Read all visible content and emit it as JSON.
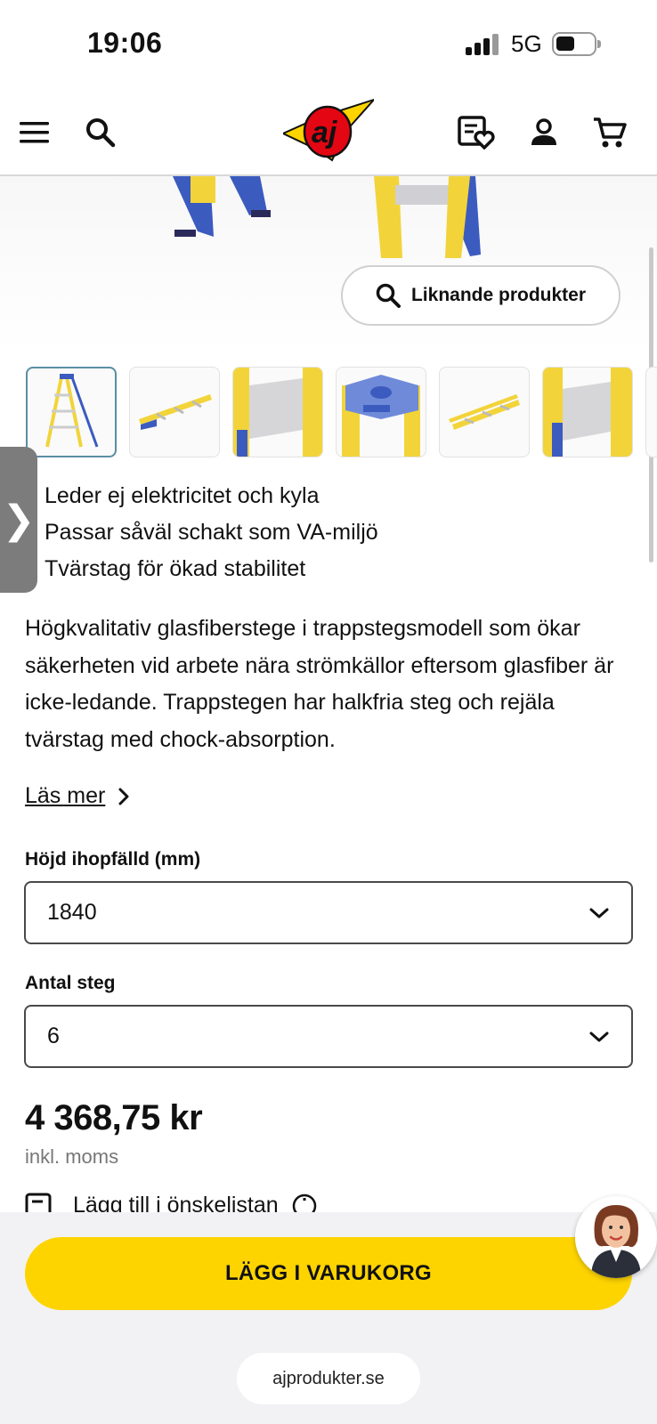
{
  "status_bar": {
    "time": "19:06",
    "network": "5G"
  },
  "header": {
    "menu_icon": "menu-icon",
    "search_icon": "search-icon",
    "logo_text": "aj",
    "wishlist_icon": "wishlist-icon",
    "account_icon": "user-icon",
    "cart_icon": "cart-icon"
  },
  "gallery": {
    "similar_label": "Liknande produkter",
    "thumbnail_count": 6,
    "active_index": 0
  },
  "side_tab": {
    "glyph": "❯"
  },
  "features": [
    "Leder ej elektricitet och kyla",
    "Passar såväl schakt som VA-miljö",
    "Tvärstag för ökad stabilitet"
  ],
  "description": "Högkvalitativ glasfiberstege i trappstegsmodell som ökar säkerheten vid arbete nära strömkällor eftersom glasfiber är icke-ledande. Trappstegen har halkfria steg och rejäla tvärstag med chock-absorption.",
  "read_more_label": "Läs mer",
  "height_field": {
    "label": "Höjd ihopfälld (mm)",
    "value": "1840"
  },
  "steps_field": {
    "label": "Antal steg",
    "value": "6"
  },
  "price": {
    "amount": "4 368,75 kr",
    "vat_note": "inkl. moms"
  },
  "wishlist_label": "Lägg till i önskelistan",
  "cart_button_label": "LÄGG I VARUKORG",
  "browser": {
    "url": "ajprodukter.se"
  },
  "colors": {
    "accent_yellow": "#fdd400",
    "logo_red": "#e30613",
    "ladder_yellow": "#f2d43a",
    "ladder_blue": "#3b5bbf"
  }
}
